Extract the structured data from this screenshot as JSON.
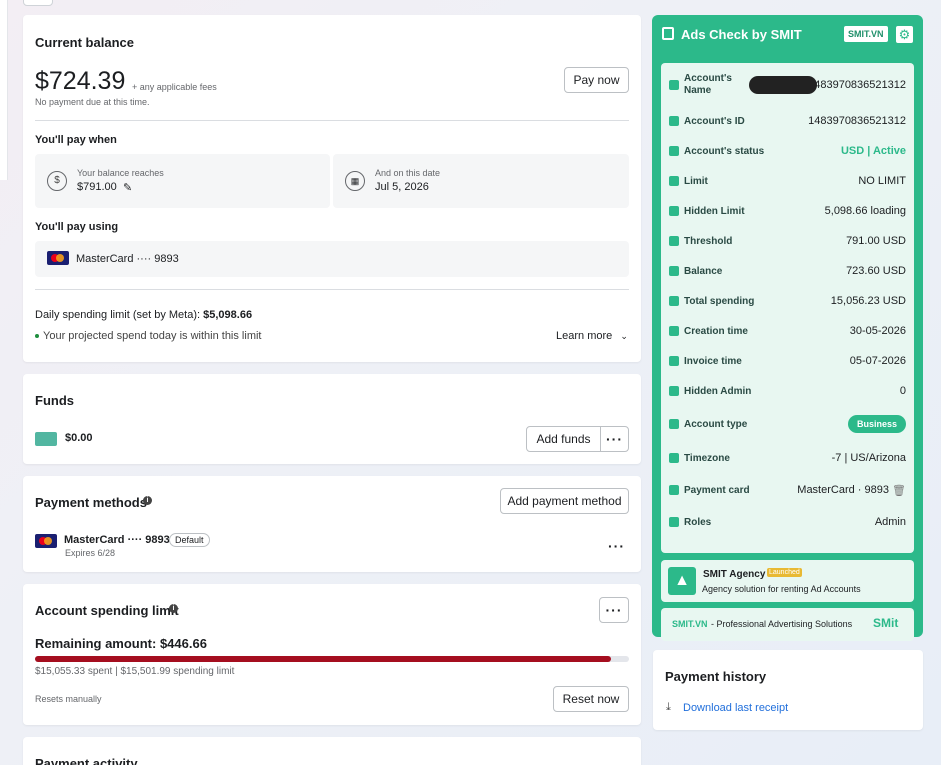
{
  "balance": {
    "title": "Current balance",
    "amount": "$724.39",
    "fees_note": "+ any applicable fees",
    "no_payment": "No payment due at this time.",
    "pay_now": "Pay now",
    "pay_when": "You'll pay when",
    "reaches_label": "Your balance reaches",
    "reaches_value": "$791.00",
    "date_label": "And on this date",
    "date_value": "Jul 5, 2026",
    "pay_using": "You'll pay using",
    "card": "MasterCard ···· 9893",
    "daily_limit_label": "Daily spending limit (set by Meta): ",
    "daily_limit_value": "$5,098.66",
    "projected": "Your projected spend today is within this limit",
    "learn_more": "Learn more"
  },
  "funds": {
    "title": "Funds",
    "amount": "$0.00",
    "add_funds": "Add funds"
  },
  "payment_methods": {
    "title": "Payment methods",
    "add": "Add payment method",
    "card": "MasterCard ···· 9893",
    "badge": "Default",
    "expires": "Expires 6/28"
  },
  "spending_limit": {
    "title": "Account spending limit",
    "remaining": "Remaining amount: $446.66",
    "progress": 0.97,
    "spent_text": "$15,055.33 spent | $15,501.99 spending limit",
    "resets": "Resets manually",
    "reset_now": "Reset now",
    "bar_color": "#a50e1f"
  },
  "payment_activity": {
    "title": "Payment activity"
  },
  "smit": {
    "title": "Ads Check by SMIT",
    "badge": "SMIT.VN",
    "accent": "#2cb98a",
    "rows": [
      {
        "label": "Account's Name",
        "value": "1483970836521312",
        "icon": "user-icon"
      },
      {
        "label": "Account's ID",
        "value": "1483970836521312",
        "icon": "id-icon"
      },
      {
        "label": "Account's status",
        "value": "USD | Active",
        "icon": "status-icon"
      },
      {
        "label": "Limit",
        "value": "NO LIMIT",
        "icon": "limit-icon"
      },
      {
        "label": "Hidden Limit",
        "value": "5,098.66 loading",
        "icon": "piggy-icon"
      },
      {
        "label": "Threshold",
        "value": "791.00 USD",
        "icon": "threshold-icon"
      },
      {
        "label": "Balance",
        "value": "723.60 USD",
        "icon": "dollar-icon"
      },
      {
        "label": "Total spending",
        "value": "15,056.23 USD",
        "icon": "spending-icon"
      },
      {
        "label": "Creation time",
        "value": "30-05-2026",
        "icon": "calendar-icon"
      },
      {
        "label": "Invoice time",
        "value": "05-07-2026",
        "icon": "invoice-icon"
      },
      {
        "label": "Hidden Admin",
        "value": "0",
        "icon": "shield-icon"
      },
      {
        "label": "Account type",
        "value": "Business",
        "icon": "briefcase-icon"
      },
      {
        "label": "Timezone",
        "value": "-7 | US/Arizona",
        "icon": "clock-icon"
      },
      {
        "label": "Payment card",
        "value": "MasterCard · 9893",
        "icon": "card-icon"
      },
      {
        "label": "Roles",
        "value": "Admin",
        "icon": "roles-icon"
      }
    ],
    "agency_name": "SMIT Agency",
    "agency_badge": "Launched",
    "agency_desc": "Agency solution for renting Ad Accounts",
    "footer_site": "SMIT.VN",
    "footer_text": " - Professional Advertising Solutions",
    "footer_logo": "SMit"
  },
  "payment_history": {
    "title": "Payment history",
    "download": "Download last receipt"
  }
}
